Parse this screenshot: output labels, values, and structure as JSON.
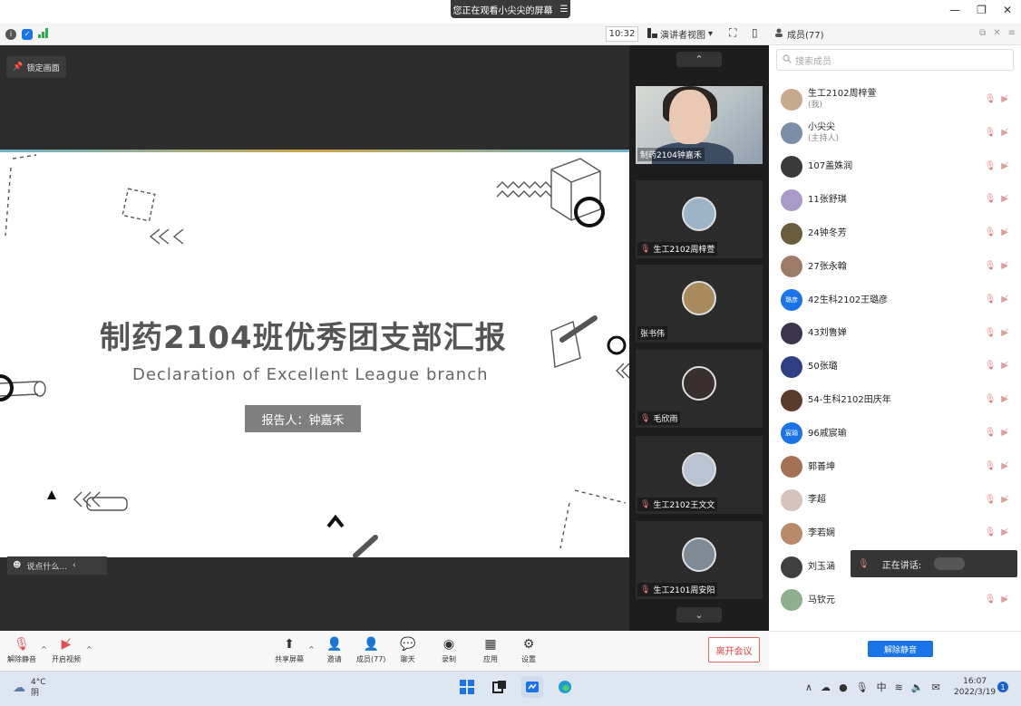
{
  "titlebar": {
    "viewing_label": "您正在观看小尖尖的屏幕",
    "menu_glyph": "☰",
    "minimize": "—",
    "restore": "❐",
    "close": "✕"
  },
  "toolbar": {
    "time": "10:32",
    "view_mode": "演讲者视图",
    "view_caret": "▾",
    "fullscreen_glyph": "⛶",
    "sidebar_glyph": "▯"
  },
  "panel": {
    "title": "成员(77)",
    "search_placeholder": "搜索成员"
  },
  "stage": {
    "lock_label": "锁定画面",
    "chat_placeholder": "说点什么..."
  },
  "slide": {
    "title": "制药2104班优秀团支部汇报",
    "subtitle": "Declaration of Excellent League branch",
    "reporter": "报告人：钟嘉禾"
  },
  "gallery": {
    "tiles": [
      {
        "name": "制药2104钟嘉禾"
      },
      {
        "name": "生工2102周梓萱"
      },
      {
        "name": "张书伟"
      },
      {
        "name": "毛欣雨"
      },
      {
        "name": "生工2102王文文"
      },
      {
        "name": "生工2101周安阳"
      }
    ]
  },
  "members": [
    {
      "name": "生工2102周梓萱",
      "sub": "(我)",
      "avatar_color": "#c7a98e"
    },
    {
      "name": "小尖尖",
      "sub": "(主持人)",
      "avatar_color": "#7c8ea5"
    },
    {
      "name": "107盖姝润",
      "sub": "",
      "avatar_color": "#3a3a3a"
    },
    {
      "name": "11张舒琪",
      "sub": "",
      "avatar_color": "#a99ac8"
    },
    {
      "name": "24钟冬芳",
      "sub": "",
      "avatar_color": "#6b5c3d"
    },
    {
      "name": "27张永翰",
      "sub": "",
      "avatar_color": "#9c7c66"
    },
    {
      "name": "42生科2102王璐彦",
      "sub": "",
      "avatar_color": "#1a73e8",
      "avatar_text": "璐彦"
    },
    {
      "name": "43刘鲁婵",
      "sub": "",
      "avatar_color": "#3c3550"
    },
    {
      "name": "50张璐",
      "sub": "",
      "avatar_color": "#2f3f86"
    },
    {
      "name": "54-生科2102田庆年",
      "sub": "",
      "avatar_color": "#5a3b2a"
    },
    {
      "name": "96戚宸瑜",
      "sub": "",
      "avatar_color": "#1a73e8",
      "avatar_text": "宸瑜"
    },
    {
      "name": "郭善坤",
      "sub": "",
      "avatar_color": "#a57154"
    },
    {
      "name": "李超",
      "sub": "",
      "avatar_color": "#d4c2bb"
    },
    {
      "name": "李若娴",
      "sub": "",
      "avatar_color": "#b88a6a"
    },
    {
      "name": "刘玉涵",
      "sub": "",
      "avatar_color": "#3f3f3f"
    },
    {
      "name": "马钦元",
      "sub": "",
      "avatar_color": "#8fb08e"
    }
  ],
  "speaking_label": "正在讲话:",
  "unmute_all_label": "解除静音",
  "controls": {
    "unmute": "解除静音",
    "start_video": "开启视频",
    "share_screen": "共享屏幕",
    "invite": "邀请",
    "members": "成员(77)",
    "chat": "聊天",
    "record": "录制",
    "apps": "应用",
    "settings": "设置",
    "leave": "离开会议"
  },
  "taskbar": {
    "temp": "4°C",
    "weather": "阴",
    "time": "16:07",
    "date": "2022/3/19",
    "ime": "中",
    "notifications": "1"
  },
  "colors": {
    "accent": "#1a73e8",
    "leave": "#e03e3e",
    "stage_bg": "#2c2c2c"
  }
}
